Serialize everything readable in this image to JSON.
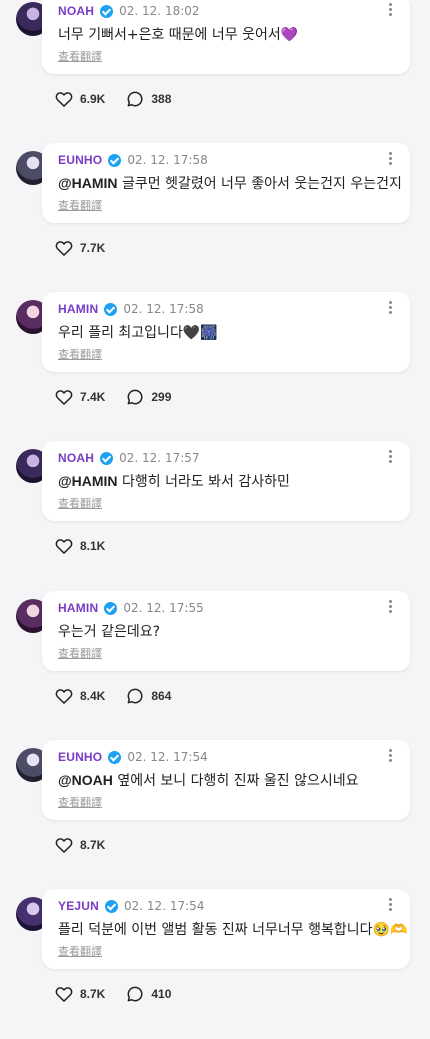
{
  "ui": {
    "translate_label": "查看翻譯"
  },
  "posts": [
    {
      "author": "NOAH",
      "time": "02. 12. 18:02",
      "mention": "",
      "text": "너무 기뻐서+은호 때문에 너무 웃어서💜",
      "likes": "6.9K",
      "comments": "388",
      "avatar": "avatar-noah"
    },
    {
      "author": "EUNHO",
      "time": "02. 12. 17:58",
      "mention": "@HAMIN",
      "text": " 글쿠먼 헷갈렸어 너무 좋아서 웃는건지 우는건지",
      "likes": "7.7K",
      "comments": "",
      "avatar": "avatar-eunho"
    },
    {
      "author": "HAMIN",
      "time": "02. 12. 17:58",
      "mention": "",
      "text": "우리 플리 최고입니다🖤🎆",
      "likes": "7.4K",
      "comments": "299",
      "avatar": "avatar-hamin"
    },
    {
      "author": "NOAH",
      "time": "02. 12. 17:57",
      "mention": "@HAMIN",
      "text": " 다행히 너라도 봐서 감사하민",
      "likes": "8.1K",
      "comments": "",
      "avatar": "avatar-noah"
    },
    {
      "author": "HAMIN",
      "time": "02. 12. 17:55",
      "mention": "",
      "text": "우는거 같은데요?",
      "likes": "8.4K",
      "comments": "864",
      "avatar": "avatar-hamin"
    },
    {
      "author": "EUNHO",
      "time": "02. 12. 17:54",
      "mention": "@NOAH",
      "text": " 옆에서 보니 다행히 진짜 울진 않으시네요",
      "likes": "8.7K",
      "comments": "",
      "avatar": "avatar-eunho"
    },
    {
      "author": "YEJUN",
      "time": "02. 12. 17:54",
      "mention": "",
      "text": "플리 덕분에 이번 앨범 활동 진짜 너무너무 행복합니다🥹🫶",
      "likes": "8.7K",
      "comments": "410",
      "avatar": "avatar-yejun"
    }
  ]
}
